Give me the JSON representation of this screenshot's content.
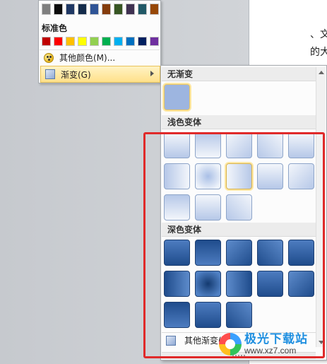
{
  "document": {
    "line1": "、文",
    "line2": "的大"
  },
  "color_menu": {
    "theme_shades": [
      "#7f7f7f",
      "#0c0c0c",
      "#1f3864",
      "#132b4a",
      "#2f5496",
      "#843c0c",
      "#375623",
      "#3f3151",
      "#215967",
      "#974806"
    ],
    "standard_label": "标准色",
    "standard_colors": [
      "#c00000",
      "#ff0000",
      "#ffc000",
      "#ffff00",
      "#92d050",
      "#00b050",
      "#00b0f0",
      "#0070c0",
      "#002060",
      "#7030a0"
    ],
    "more_colors_label": "其他颜色(M)...",
    "more_colors_icon": "palette-icon",
    "gradient_label": "渐变(G)",
    "gradient_icon": "gradient-icon"
  },
  "gradient_panel": {
    "no_gradient_header": "无渐变",
    "no_gradient_color": "#9db5e0",
    "light_header": "浅色变体",
    "dark_header": "深色变体",
    "more_label": "其他渐变(M)...",
    "light_variants": 13,
    "dark_variants": 13,
    "selected_light_variant": 8
  },
  "watermark": {
    "main": "极光下载站",
    "sub": "www.xz7.com"
  },
  "accent": {
    "highlight": "#e02a2a",
    "selection": "#ffe08a"
  }
}
